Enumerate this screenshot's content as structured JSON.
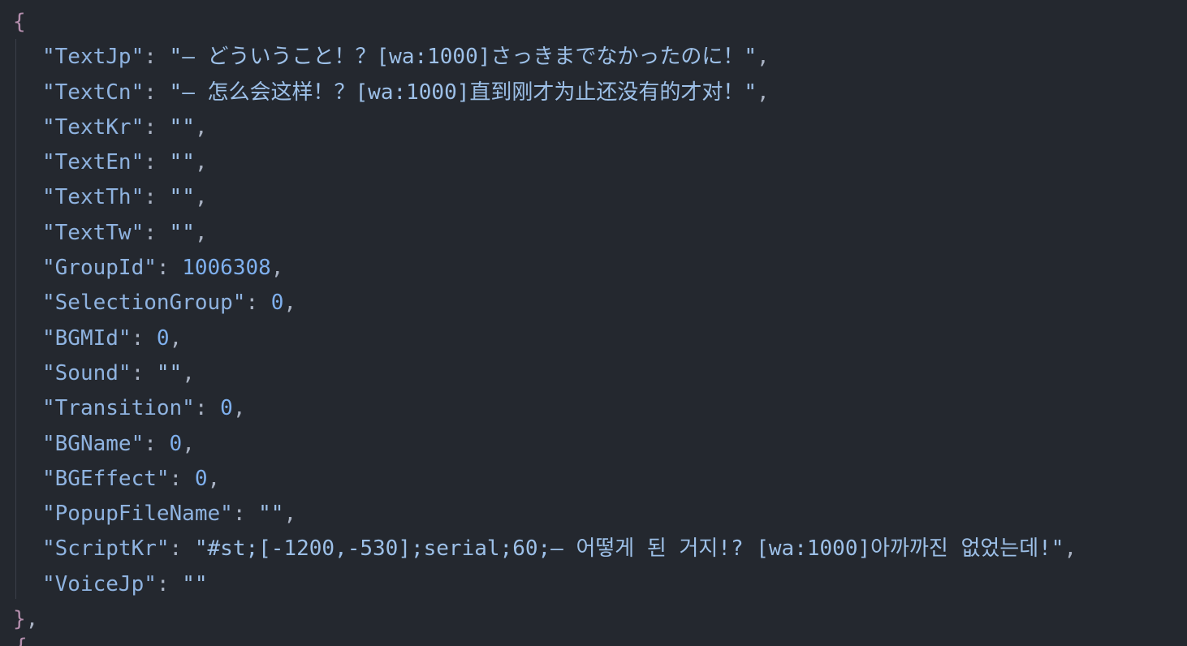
{
  "editor": {
    "open_brace": "{",
    "close_brace": "}",
    "close_suffix": ",",
    "next_brace": "{",
    "lines": [
      {
        "key": "\"TextJp\"",
        "value": "\"— どういうこと！？[wa:1000]さっきまでなかったのに！\"",
        "type": "str",
        "comma": ","
      },
      {
        "key": "\"TextCn\"",
        "value": "\"— 怎么会这样！？[wa:1000]直到刚才为止还没有的才对！\"",
        "type": "str",
        "comma": ","
      },
      {
        "key": "\"TextKr\"",
        "value": "\"\"",
        "type": "str",
        "comma": ","
      },
      {
        "key": "\"TextEn\"",
        "value": "\"\"",
        "type": "str",
        "comma": ","
      },
      {
        "key": "\"TextTh\"",
        "value": "\"\"",
        "type": "str",
        "comma": ","
      },
      {
        "key": "\"TextTw\"",
        "value": "\"\"",
        "type": "str",
        "comma": ","
      },
      {
        "key": "\"GroupId\"",
        "value": "1006308",
        "type": "num",
        "comma": ","
      },
      {
        "key": "\"SelectionGroup\"",
        "value": "0",
        "type": "num",
        "comma": ","
      },
      {
        "key": "\"BGMId\"",
        "value": "0",
        "type": "num",
        "comma": ","
      },
      {
        "key": "\"Sound\"",
        "value": "\"\"",
        "type": "str",
        "comma": ","
      },
      {
        "key": "\"Transition\"",
        "value": "0",
        "type": "num",
        "comma": ","
      },
      {
        "key": "\"BGName\"",
        "value": "0",
        "type": "num",
        "comma": ","
      },
      {
        "key": "\"BGEffect\"",
        "value": "0",
        "type": "num",
        "comma": ","
      },
      {
        "key": "\"PopupFileName\"",
        "value": "\"\"",
        "type": "str",
        "comma": ","
      },
      {
        "key": "\"ScriptKr\"",
        "value": "\"#st;[-1200,-530];serial;60;— 어떻게 된 거지!? [wa:1000]아까까진 없었는데!\"",
        "type": "str",
        "comma": ","
      },
      {
        "key": "\"VoiceJp\"",
        "value": "\"\"",
        "type": "str",
        "comma": ""
      }
    ]
  }
}
